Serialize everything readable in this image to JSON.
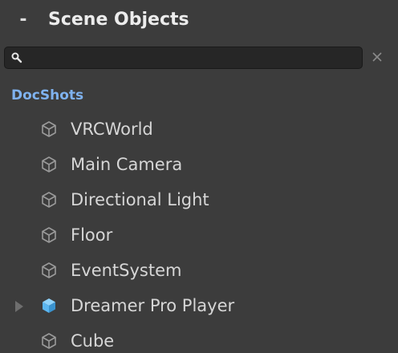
{
  "header": {
    "collapse_symbol": "-",
    "title": "Scene Objects"
  },
  "search": {
    "value": "",
    "placeholder": ""
  },
  "section": {
    "label": "DocShots"
  },
  "items": [
    {
      "label": "VRCWorld",
      "icon": "cube-outline-icon",
      "expandable": false
    },
    {
      "label": "Main Camera",
      "icon": "cube-outline-icon",
      "expandable": false
    },
    {
      "label": "Directional Light",
      "icon": "cube-outline-icon",
      "expandable": false
    },
    {
      "label": "Floor",
      "icon": "cube-outline-icon",
      "expandable": false
    },
    {
      "label": "EventSystem",
      "icon": "cube-outline-icon",
      "expandable": false
    },
    {
      "label": "Dreamer Pro Player",
      "icon": "prefab-cube-icon",
      "expandable": true
    },
    {
      "label": "Cube",
      "icon": "cube-outline-icon",
      "expandable": false
    }
  ],
  "colors": {
    "background": "#3c3c3c",
    "section_label": "#7fb2ef",
    "prefab_icon": "#5bb6f0",
    "text": "#d6d6d6"
  }
}
